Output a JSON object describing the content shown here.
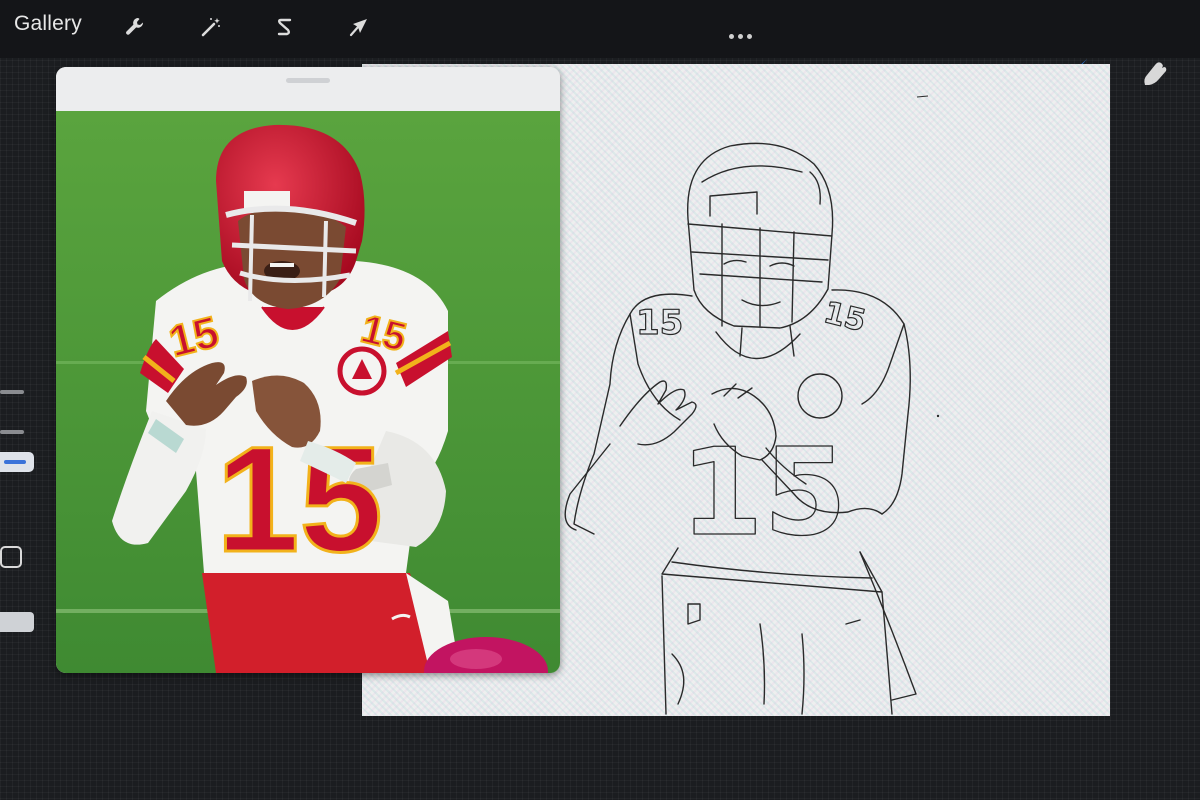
{
  "toolbar": {
    "gallery_label": "Gallery",
    "actions_icon": "wrench-icon",
    "adjustments_icon": "magic-wand-icon",
    "selection_icon": "selection-s-icon",
    "transform_icon": "arrow-cursor-icon",
    "more_icon": "ellipsis-icon"
  },
  "right_tools": {
    "brush_icon": "brush-icon",
    "smudge_icon": "smudge-finger-icon",
    "active_color": "#2f7de1"
  },
  "reference": {
    "jersey_number": "15",
    "colors": {
      "field": "#4f9a3a",
      "helmet": "#c8102e",
      "pants": "#d21f2b",
      "jersey": "#f4f4f2",
      "trim": "#f2b21b"
    }
  },
  "canvas": {
    "line_color": "#2a2a2a"
  }
}
